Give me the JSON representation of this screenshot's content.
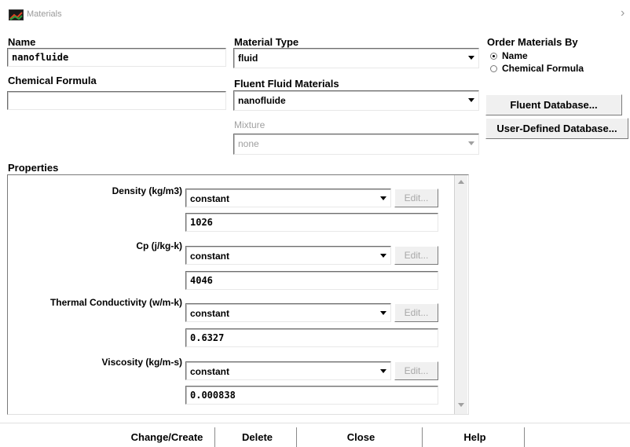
{
  "window": {
    "title": "Materials",
    "close_glyph": "›",
    "app_icon": "fluent-app-icon"
  },
  "name": {
    "label": "Name",
    "value": "nanofluide"
  },
  "chemical_formula": {
    "label": "Chemical Formula",
    "value": ""
  },
  "material_type": {
    "label": "Material Type",
    "value": "fluid"
  },
  "fluent_fluid_materials": {
    "label": "Fluent Fluid Materials",
    "value": "nanofluide"
  },
  "mixture": {
    "label": "Mixture",
    "value": "none"
  },
  "order_by": {
    "label": "Order Materials By",
    "options": [
      {
        "label": "Name",
        "selected": true
      },
      {
        "label": "Chemical Formula",
        "selected": false
      }
    ]
  },
  "database_buttons": {
    "fluent": "Fluent Database...",
    "user_defined": "User-Defined Database..."
  },
  "properties": {
    "label": "Properties",
    "items": [
      {
        "label": "Density (kg/m3)",
        "method": "constant",
        "edit": "Edit...",
        "value": "1026"
      },
      {
        "label": "Cp (j/kg-k)",
        "method": "constant",
        "edit": "Edit...",
        "value": "4046"
      },
      {
        "label": "Thermal Conductivity (w/m-k)",
        "method": "constant",
        "edit": "Edit...",
        "value": "0.6327"
      },
      {
        "label": "Viscosity (kg/m-s)",
        "method": "constant",
        "edit": "Edit...",
        "value": "0.000838"
      }
    ]
  },
  "footer": {
    "change_create": "Change/Create",
    "delete": "Delete",
    "close": "Close",
    "help": "Help"
  }
}
